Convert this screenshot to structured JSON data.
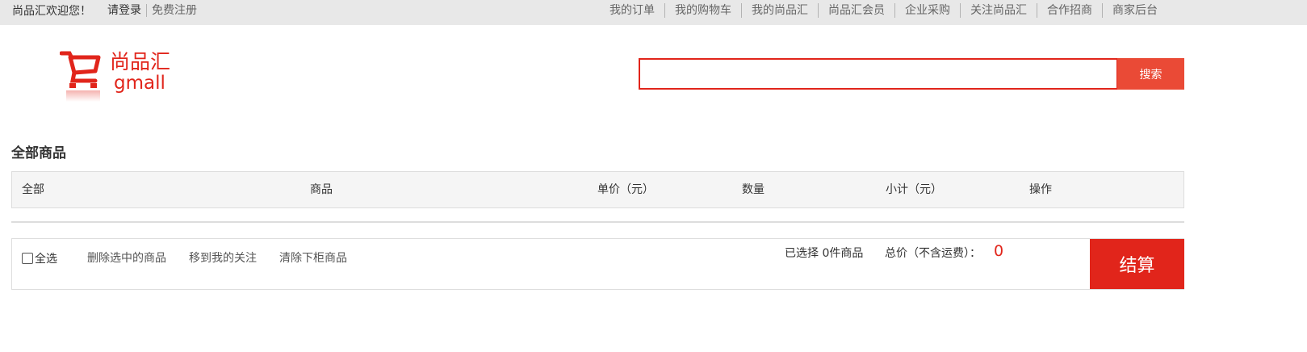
{
  "topbar": {
    "welcome": "尚品汇欢迎您！",
    "login": "请登录",
    "register": "免费注册",
    "nav": [
      "我的订单",
      "我的购物车",
      "我的尚品汇",
      "尚品汇会员",
      "企业采购",
      "关注尚品汇",
      "合作招商",
      "商家后台"
    ]
  },
  "header": {
    "logo_cn": "尚品汇",
    "logo_en": "gmall",
    "search_value": "",
    "search_button": "搜索"
  },
  "cart": {
    "title": "全部商品",
    "columns": [
      "全部",
      "商品",
      "单价（元）",
      "数量",
      "小计（元）",
      "操作"
    ]
  },
  "footer": {
    "select_all": "全选",
    "actions": [
      "删除选中的商品",
      "移到我的关注",
      "清除下柜商品"
    ],
    "selected_count": "已选择 0件商品",
    "total_label": "总价（不含运费）：",
    "total_value": "0",
    "checkout": "结算"
  },
  "colors": {
    "brand_red": "#e1251b",
    "search_button": "#ea4a36",
    "topbar_bg": "#e8e8e8"
  }
}
